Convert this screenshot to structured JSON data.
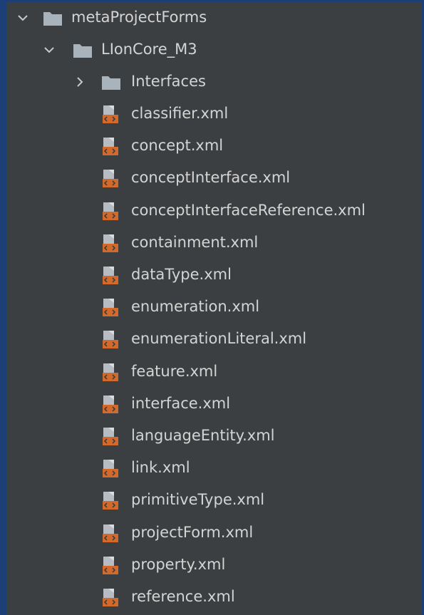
{
  "tree": {
    "root": {
      "label": "metaProjectForms",
      "icon": "folder-icon",
      "expanded": true
    },
    "child": {
      "label": "LIonCore_M3",
      "icon": "folder-icon",
      "expanded": true
    },
    "subfolder": {
      "label": "Interfaces",
      "icon": "folder-icon",
      "expanded": false
    },
    "files": [
      "classifier.xml",
      "concept.xml",
      "conceptInterface.xml",
      "conceptInterfaceReference.xml",
      "containment.xml",
      "dataType.xml",
      "enumeration.xml",
      "enumerationLiteral.xml",
      "feature.xml",
      "interface.xml",
      "languageEntity.xml",
      "link.xml",
      "primitiveType.xml",
      "projectForm.xml",
      "property.xml",
      "reference.xml"
    ]
  },
  "colors": {
    "frame": "#1c3f78",
    "panel": "#3c3f41",
    "text": "#d4d4d4",
    "folder": "#a9b3bc",
    "file_icon_top": "#b7bcc2",
    "file_icon_badge": "#d36a2c"
  }
}
